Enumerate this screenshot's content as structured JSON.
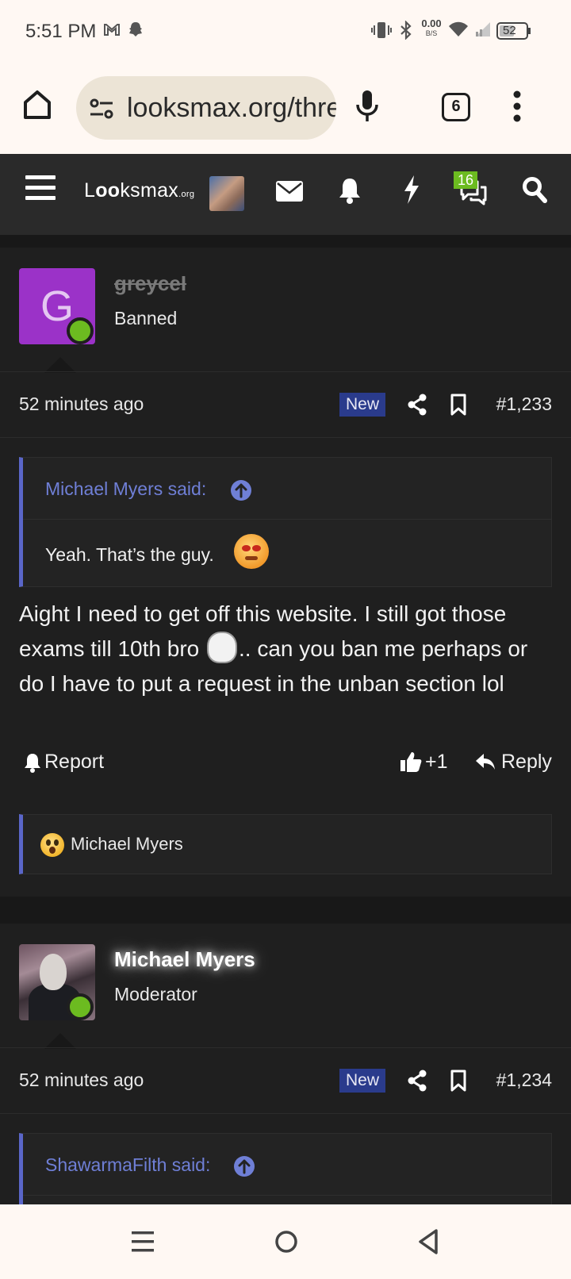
{
  "status_bar": {
    "time": "5:51 PM",
    "net_speed": "0.00",
    "net_unit": "B/S",
    "battery": "52"
  },
  "browser": {
    "url": "looksmax.org/threads/",
    "tab_count": "6"
  },
  "site_header": {
    "logo_pre": "L",
    "logo_oo": "oo",
    "logo_post": "ksmax",
    "logo_suffix": ".org",
    "conversations_badge": "16"
  },
  "posts": [
    {
      "avatar_letter": "G",
      "username": "greyceI",
      "user_title": "Banned",
      "time": "52 minutes ago",
      "new_label": "New",
      "post_number": "#1,233",
      "quote": {
        "attribution": "Michael Myers said:",
        "text": "Yeah. That’s the guy."
      },
      "message_part1": "Aight I need to get off this website. I still got those exams till 10th bro",
      "message_part2": ".. can you ban me perhaps or do I have to put a request in the unban section lol",
      "report_label": "Report",
      "like_count": "+1",
      "reply_label": "Reply",
      "reaction_user": "Michael Myers"
    },
    {
      "username": "Michael Myers",
      "user_title": "Moderator",
      "time": "52 minutes ago",
      "new_label": "New",
      "post_number": "#1,234",
      "quote": {
        "attribution": "ShawarmaFilth said:"
      }
    }
  ]
}
